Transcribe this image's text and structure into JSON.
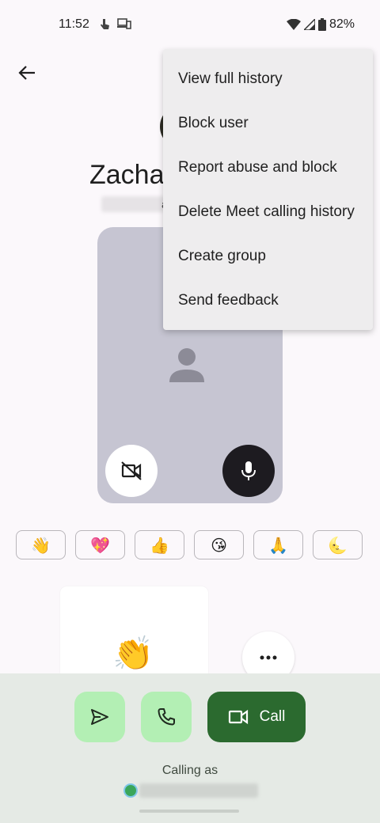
{
  "status_bar": {
    "time": "11:52",
    "battery": "82%"
  },
  "contact": {
    "name": "Zachar",
    "sub_char": "a"
  },
  "reactions": [
    "👋",
    "💖",
    "👍",
    "😘",
    "🙏",
    "🌜"
  ],
  "message": {
    "emoji": "👏"
  },
  "actions": {
    "call_label": "Call"
  },
  "footer": {
    "calling_as": "Calling as"
  },
  "menu": {
    "items": [
      "View full history",
      "Block user",
      "Report abuse and block",
      "Delete Meet calling history",
      "Create group",
      "Send feedback"
    ]
  },
  "colors": {
    "accent_dark_green": "#2b6a2f",
    "accent_light_green": "#b3efb4",
    "preview_bg": "#c6c5d2",
    "menu_bg": "#eeedee"
  }
}
